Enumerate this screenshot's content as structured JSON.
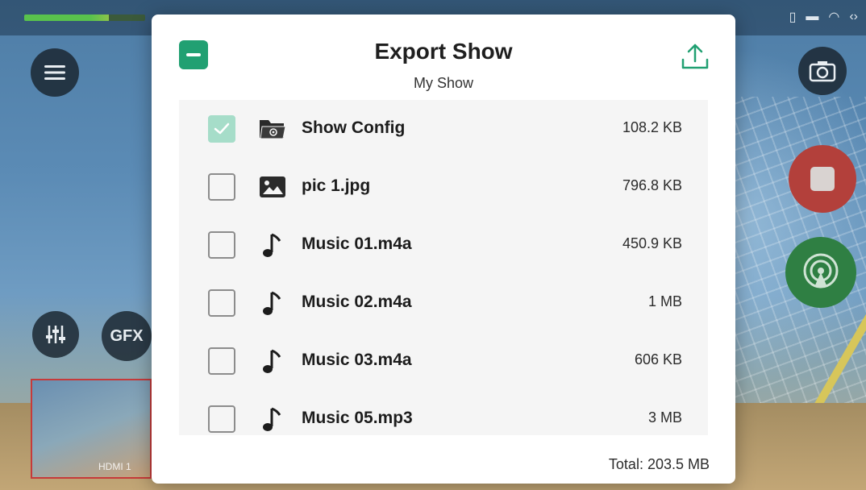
{
  "background": {
    "preview_label": "HDMI 1",
    "gfx_label": "GFX",
    "colors": {
      "record": "#b3403b",
      "live": "#2f7f43"
    }
  },
  "dialog": {
    "title": "Export Show",
    "subtitle": "My Show",
    "accent_color": "#21a072",
    "select_all_icon": "minus-square-icon",
    "share_icon": "upload-icon",
    "files": [
      {
        "name": "Show Config",
        "size": "108.2 KB",
        "icon": "folder-settings-icon",
        "checked": true
      },
      {
        "name": "pic 1.jpg",
        "size": "796.8 KB",
        "icon": "image-icon",
        "checked": false
      },
      {
        "name": "Music 01.m4a",
        "size": "450.9 KB",
        "icon": "music-note-icon",
        "checked": false
      },
      {
        "name": "Music 02.m4a",
        "size": "1 MB",
        "icon": "music-note-icon",
        "checked": false
      },
      {
        "name": "Music 03.m4a",
        "size": "606 KB",
        "icon": "music-note-icon",
        "checked": false
      },
      {
        "name": "Music 05.mp3",
        "size": "3 MB",
        "icon": "music-note-icon",
        "checked": false
      }
    ],
    "total": "Total: 203.5 MB"
  }
}
